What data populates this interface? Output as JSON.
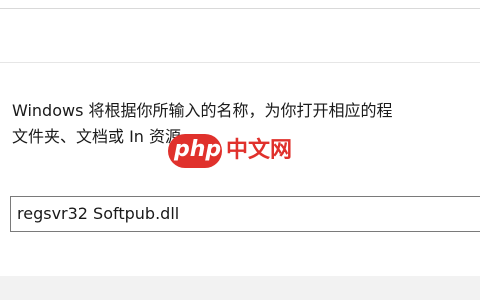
{
  "dialog": {
    "description_line1": "Windows 将根据你所输入的名称，为你打开相应的程",
    "description_line2": "文件夹、文档或 In              资源。"
  },
  "watermark": {
    "brand_php": "php",
    "brand_cn": "中文网",
    "brand_color": "#e0312c"
  },
  "input": {
    "value": "regsvr32 Softpub.dll"
  }
}
